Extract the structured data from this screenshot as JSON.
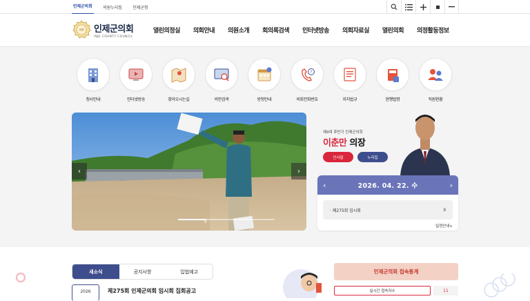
{
  "top_links": [
    {
      "label": "인제군의회",
      "active": true
    },
    {
      "label": "의원누리집",
      "active": false
    },
    {
      "label": "인제군청",
      "active": false
    }
  ],
  "top_icons": [
    "search-icon",
    "menu-list-icon",
    "zoom-in-icon",
    "reset-icon",
    "zoom-out-icon"
  ],
  "logo": {
    "name": "인제군의회",
    "english": "INJE COUNTY COUNCIL",
    "seal_text": "인제군의회"
  },
  "gnb": [
    "열린의정실",
    "의회안내",
    "의원소개",
    "회의록검색",
    "인터넷방송",
    "의회자료실",
    "열린의회",
    "의정활동정보"
  ],
  "quick_menu": [
    {
      "label": "청사안내",
      "icon": "building-icon"
    },
    {
      "label": "인터넷방송",
      "icon": "broadcast-icon"
    },
    {
      "label": "찾아오시는길",
      "icon": "map-icon"
    },
    {
      "label": "의안검색",
      "icon": "bill-search-icon"
    },
    {
      "label": "방청안내",
      "icon": "calendar-icon"
    },
    {
      "label": "의회전화번호",
      "icon": "phone-icon"
    },
    {
      "label": "자치법규",
      "icon": "law-icon"
    },
    {
      "label": "현행법령",
      "icon": "book-icon"
    },
    {
      "label": "직원현황",
      "icon": "staff-icon"
    }
  ],
  "slider": {
    "prev": "‹",
    "next": "›",
    "pause": "II",
    "progress": 0.29
  },
  "chairman": {
    "term": "제9대 후반기 인제군의회",
    "name": "이춘만",
    "title": "의장",
    "greeting_button": "인사말",
    "homepage_button": "누리집"
  },
  "calendar": {
    "date": "2026. 04. 22. 수",
    "prev": "‹",
    "next": "›",
    "event": "· 제275회 임시회",
    "event_mark": "II",
    "more": "일정안내+"
  },
  "news": {
    "tabs": [
      "새소식",
      "공지사항",
      "입법예고"
    ],
    "active_tab": 0,
    "date_year": "2026",
    "headline": "제275회 인제군의회 임시회 집회공고"
  },
  "stats": {
    "title": "인제군의회 접속통계",
    "label": "실시간 접속자수",
    "value": "11"
  },
  "colors": {
    "primary": "#3e4d8c",
    "accent": "#d9263c",
    "calendar": "#6a74b9",
    "stat_bg": "#f3d1c5"
  }
}
